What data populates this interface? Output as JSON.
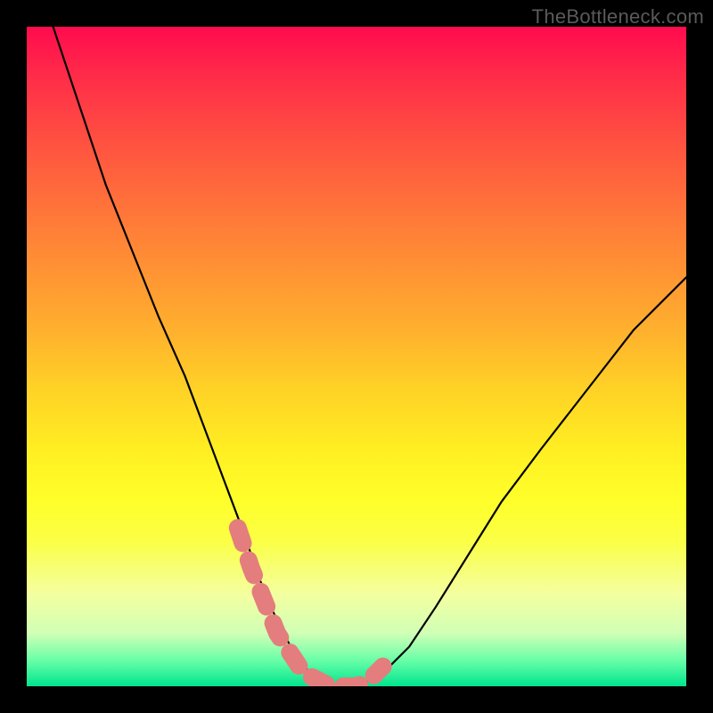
{
  "watermark": "TheBottleneck.com",
  "chart_data": {
    "type": "line",
    "title": "",
    "xlabel": "",
    "ylabel": "",
    "xlim": [
      0,
      100
    ],
    "ylim": [
      0,
      100
    ],
    "series": [
      {
        "name": "main-curve",
        "x": [
          4,
          8,
          12,
          16,
          20,
          24,
          27,
          30,
          33,
          35,
          37,
          40,
          42,
          44,
          46,
          50,
          54,
          58,
          62,
          67,
          72,
          78,
          85,
          92,
          100
        ],
        "y": [
          100,
          88,
          76,
          66,
          56,
          47,
          39,
          31,
          23,
          17,
          12,
          6,
          3,
          1,
          0,
          0,
          2,
          6,
          12,
          20,
          28,
          36,
          45,
          54,
          62
        ]
      },
      {
        "name": "highlight-segment",
        "x": [
          32,
          34,
          36,
          38,
          40,
          42,
          44,
          46,
          48,
          50,
          52,
          54
        ],
        "y": [
          24,
          18,
          13,
          8,
          5,
          2,
          1,
          0,
          0,
          0,
          1,
          3
        ]
      }
    ]
  }
}
